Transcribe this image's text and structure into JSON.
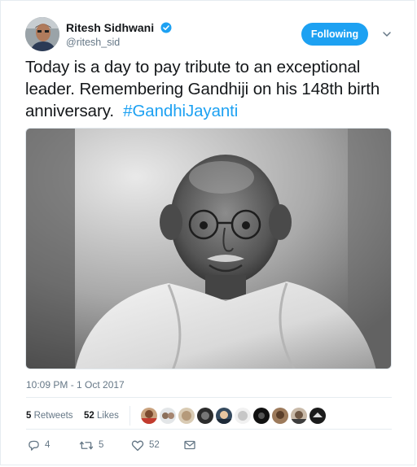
{
  "tweet": {
    "author": {
      "display_name": "Ritesh Sidhwani",
      "handle": "@ritesh_sid",
      "verified": true
    },
    "follow_button_label": "Following",
    "text_parts": {
      "body": "Today is a day to pay tribute to an exceptional leader. Remembering Gandhiji on his 148th birth anniversary.",
      "hashtag": "#GandhiJayanti"
    },
    "timestamp": "10:09 PM - 1 Oct 2017"
  },
  "stats": {
    "retweets_count": "5",
    "retweets_label": "Retweets",
    "likes_count": "52",
    "likes_label": "Likes",
    "liker_avatar_count": 10
  },
  "actions": {
    "reply_count": "4",
    "retweet_count": "5",
    "like_count": "52"
  },
  "icons": {
    "verified": "verified-badge-icon",
    "caret": "chevron-down-icon",
    "reply": "reply-icon",
    "retweet": "retweet-icon",
    "like": "heart-icon",
    "dm": "envelope-icon"
  },
  "colors": {
    "accent": "#1da1f2",
    "text": "#14171a",
    "muted": "#657786",
    "border": "#e6ecf0"
  }
}
